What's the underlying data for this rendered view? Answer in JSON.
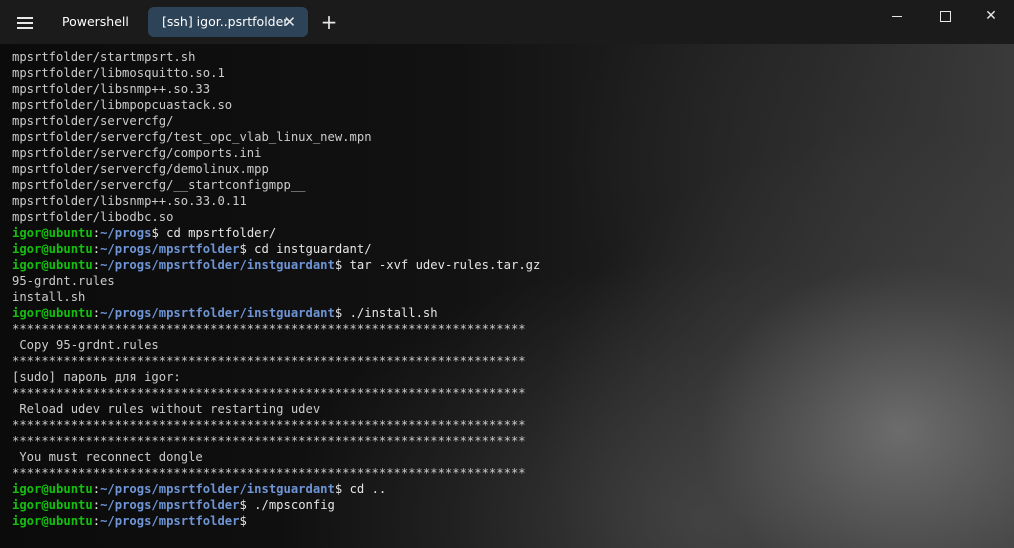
{
  "titlebar": {
    "menu_icon": "hamburger-menu-icon",
    "tabs": [
      {
        "label": "Powershell",
        "active": false
      },
      {
        "label": "[ssh] igor..psrtfolder",
        "active": true,
        "close_label": "✕"
      }
    ],
    "new_tab_label": "+",
    "window_controls": {
      "minimize_icon": "minimize-icon",
      "maximize_icon": "maximize-icon",
      "close_label": "✕"
    },
    "colors": {
      "titlebar_bg": "#1b1b1b",
      "active_tab_bg": "#2d4358"
    }
  },
  "terminal": {
    "colors": {
      "user_host": "#13c00e",
      "path": "#6f95d6",
      "text": "#cccccc"
    },
    "lines": [
      {
        "type": "out",
        "text": "mpsrtfolder/startmpsrt.sh"
      },
      {
        "type": "out",
        "text": "mpsrtfolder/libmosquitto.so.1"
      },
      {
        "type": "out",
        "text": "mpsrtfolder/libsnmp++.so.33"
      },
      {
        "type": "out",
        "text": "mpsrtfolder/libmpopcuastack.so"
      },
      {
        "type": "out",
        "text": "mpsrtfolder/servercfg/"
      },
      {
        "type": "out",
        "text": "mpsrtfolder/servercfg/test_opc_vlab_linux_new.mpn"
      },
      {
        "type": "out",
        "text": "mpsrtfolder/servercfg/comports.ini"
      },
      {
        "type": "out",
        "text": "mpsrtfolder/servercfg/demolinux.mpp"
      },
      {
        "type": "out",
        "text": "mpsrtfolder/servercfg/__startconfigmpp__"
      },
      {
        "type": "out",
        "text": "mpsrtfolder/libsnmp++.so.33.0.11"
      },
      {
        "type": "out",
        "text": "mpsrtfolder/libodbc.so"
      },
      {
        "type": "prompt",
        "user": "igor@ubuntu",
        "sep": ":",
        "path": "~/progs",
        "dollar": "$ ",
        "cmd": "cd mpsrtfolder/"
      },
      {
        "type": "prompt",
        "user": "igor@ubuntu",
        "sep": ":",
        "path": "~/progs/mpsrtfolder",
        "dollar": "$ ",
        "cmd": "cd instguardant/"
      },
      {
        "type": "prompt",
        "user": "igor@ubuntu",
        "sep": ":",
        "path": "~/progs/mpsrtfolder/instguardant",
        "dollar": "$ ",
        "cmd": "tar -xvf udev-rules.tar.gz"
      },
      {
        "type": "out",
        "text": "95-grdnt.rules"
      },
      {
        "type": "out",
        "text": "install.sh"
      },
      {
        "type": "prompt",
        "user": "igor@ubuntu",
        "sep": ":",
        "path": "~/progs/mpsrtfolder/instguardant",
        "dollar": "$ ",
        "cmd": "./install.sh"
      },
      {
        "type": "out",
        "text": "**********************************************************************"
      },
      {
        "type": "out",
        "text": " Copy 95-grdnt.rules"
      },
      {
        "type": "out",
        "text": "**********************************************************************"
      },
      {
        "type": "out",
        "text": "[sudo] пароль для igor:"
      },
      {
        "type": "out",
        "text": "**********************************************************************"
      },
      {
        "type": "out",
        "text": " Reload udev rules without restarting udev"
      },
      {
        "type": "out",
        "text": "**********************************************************************"
      },
      {
        "type": "out",
        "text": "**********************************************************************"
      },
      {
        "type": "out",
        "text": " You must reconnect dongle"
      },
      {
        "type": "out",
        "text": "**********************************************************************"
      },
      {
        "type": "prompt",
        "user": "igor@ubuntu",
        "sep": ":",
        "path": "~/progs/mpsrtfolder/instguardant",
        "dollar": "$ ",
        "cmd": "cd .."
      },
      {
        "type": "prompt",
        "user": "igor@ubuntu",
        "sep": ":",
        "path": "~/progs/mpsrtfolder",
        "dollar": "$ ",
        "cmd": "./mpsconfig"
      },
      {
        "type": "prompt",
        "user": "igor@ubuntu",
        "sep": ":",
        "path": "~/progs/mpsrtfolder",
        "dollar": "$",
        "cmd": ""
      }
    ]
  }
}
